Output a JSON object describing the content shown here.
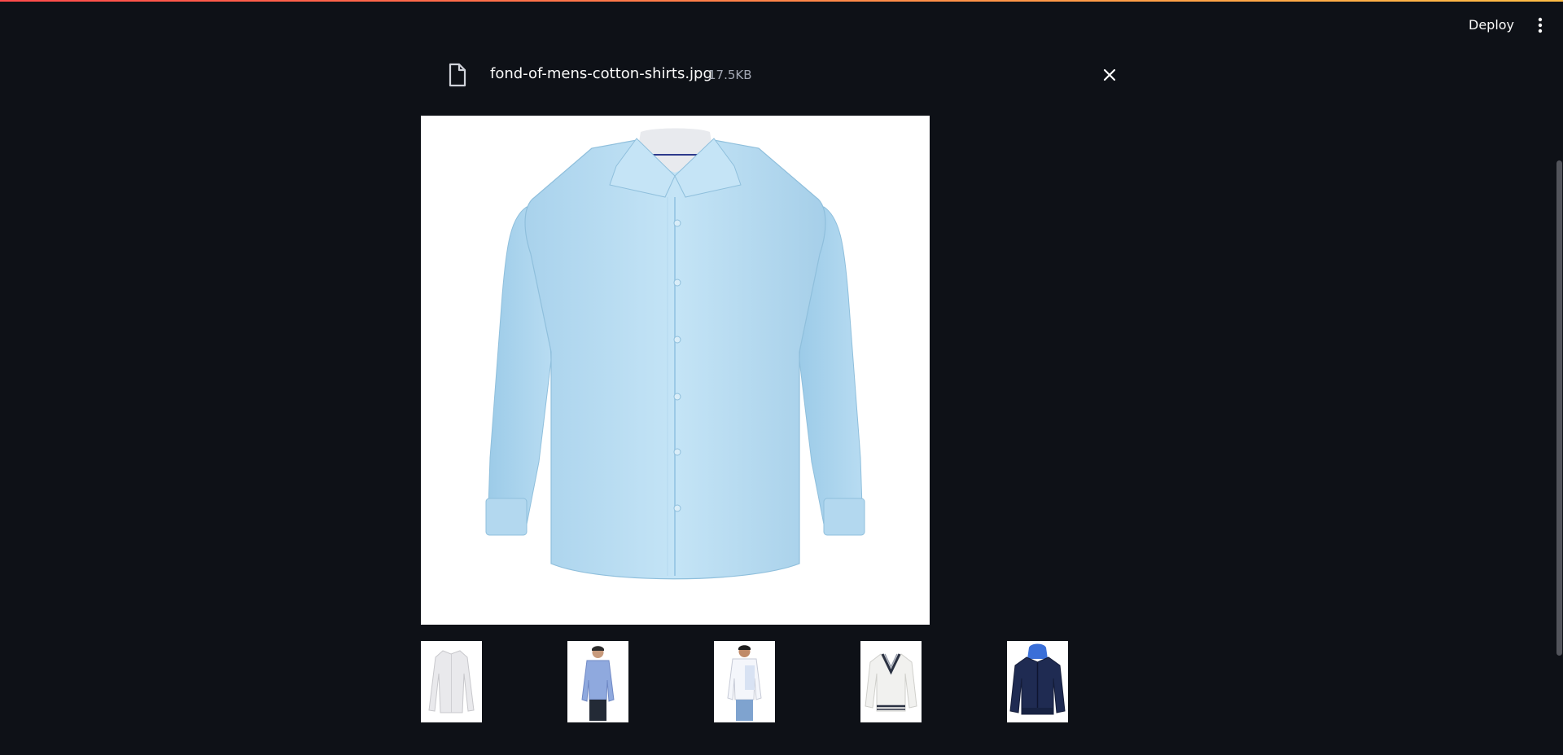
{
  "header": {
    "deploy_label": "Deploy",
    "menu_icon": "vertical-dots-icon"
  },
  "file": {
    "icon": "file-icon",
    "name": "fond-of-mens-cotton-shirts.jpg",
    "size": "17.5KB",
    "close_icon": "close-icon"
  },
  "colors": {
    "background": "#0e1117",
    "text": "#fafafa",
    "muted_text": "#a3a8b4",
    "accent_gradient_start": "#ff4b4b",
    "accent_gradient_end": "#ffbd45"
  },
  "thumbnails": [
    {
      "name": "white-shirt-thumbnail"
    },
    {
      "name": "blue-shirt-model-thumbnail"
    },
    {
      "name": "white-casual-shirt-model-thumbnail"
    },
    {
      "name": "cricket-sweater-thumbnail"
    },
    {
      "name": "navy-hoodie-jacket-thumbnail"
    }
  ]
}
